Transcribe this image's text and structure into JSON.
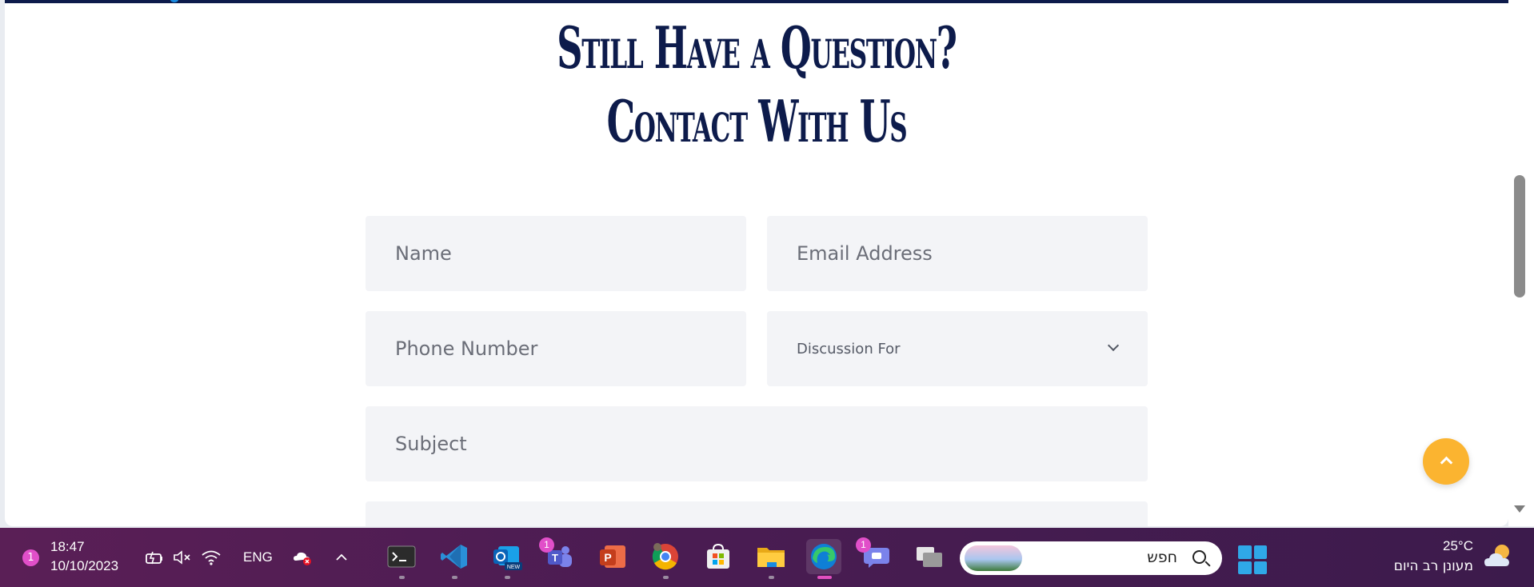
{
  "page": {
    "heading_line1": "Still Have a Question?",
    "heading_line2": "Contact With Us"
  },
  "form": {
    "name_placeholder": "Name",
    "email_placeholder": "Email Address",
    "phone_placeholder": "Phone Number",
    "discussion_label": "Discussion For",
    "subject_placeholder": "Subject"
  },
  "colors": {
    "heading": "#0d1b4b",
    "field_bg": "#f3f4f7",
    "scroll_top_button": "#fbb430",
    "taskbar": "#4a1c52",
    "badge": "#e14fc9"
  },
  "taskbar": {
    "notification_count": "1",
    "time": "18:47",
    "date": "10/10/2023",
    "language": "ENG",
    "tray_icons": [
      "battery-icon",
      "mute-icon",
      "wifi-icon",
      "onedrive-error-icon",
      "chevron-up-icon"
    ],
    "apps": [
      {
        "name": "terminal-icon"
      },
      {
        "name": "vscode-icon"
      },
      {
        "name": "outlook-new-icon",
        "tag": "NEW"
      },
      {
        "name": "teams-icon",
        "badge": "1"
      },
      {
        "name": "powerpoint-icon",
        "letter": "P"
      },
      {
        "name": "chrome-icon"
      },
      {
        "name": "microsoft-store-icon"
      },
      {
        "name": "file-explorer-icon"
      },
      {
        "name": "edge-icon"
      },
      {
        "name": "teams-chat-icon",
        "badge": "1"
      },
      {
        "name": "task-view-icon"
      }
    ],
    "search_text": "חפש",
    "weather_temp": "25°C",
    "weather_desc": "מעונן רב היום"
  }
}
